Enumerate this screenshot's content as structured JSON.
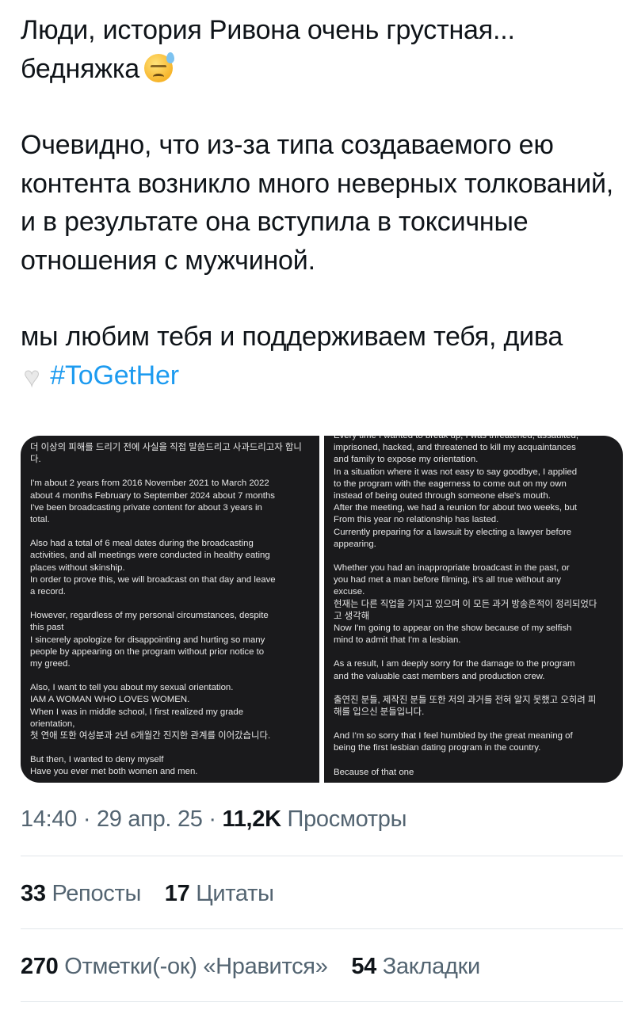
{
  "tweet": {
    "line1": "Люди, история Ривона очень грустная...",
    "line2": "бедняжка",
    "emoji_sad": "downcast-face-with-sweat-emoji",
    "para2": "Очевидно, что из-за типа создаваемого ею контента возникло много неверных толкований, и в результате она вступила в токсичные отношения с мужчиной.",
    "para3_text": "мы любим тебя и поддерживаем тебя, дива",
    "emoji_heart": "white-heart-emoji",
    "hashtag": "#ToGetHer",
    "hashtag_color": "#1d9bf0"
  },
  "media": {
    "left_paragraphs": [
      "더 이상의 피해를 드리기 전에 사실을 직접 말씀드리고 사과드리고자 합니다.",
      "I'm about 2 years from 2016 November 2021 to March 2022\nabout 4 months February to September 2024 about 7 months\nI've been broadcasting private content for about 3 years in\ntotal.",
      "Also had a total of 6 meal dates during the broadcasting\nactivities, and all meetings were conducted in healthy eating\nplaces without skinship.\nIn order to prove this, we will broadcast on that day and leave\na record.",
      "However, regardless of my personal circumstances, despite\nthis past\nI sincerely apologize for disappointing and hurting so many\npeople by appearing on the program without prior notice to\nmy greed.",
      "Also, I want to tell you about my sexual orientation.\nIAM A WOMAN WHO LOVES WOMEN.\nWhen I was in middle school, I first realized my grade\norientation,\n 첫 연애 또한 여성분과 2년 6개월간 진지한 관계를 이어갔습니다.",
      "But then, I wanted to deny myself\nHave you ever met both women and men."
    ],
    "right_paragraphs": [
      "Every time I wanted to break up, I was threatened, assaulted,\nimprisoned, hacked, and threatened to kill my acquaintances\nand family to expose my orientation.\nIn a situation where it was not easy to say goodbye, I applied\nto the program with the eagerness to come out on my own\ninstead of being outed through someone else's mouth.\nAfter the meeting, we had a reunion for about two weeks, but\nFrom this year no relationship has lasted.\nCurrently preparing for a lawsuit by electing a lawyer before\nappearing.",
      "Whether you had an inappropriate broadcast in the past, or\nyou had met a man before filming, it's all true without any\nexcuse.\n 현재는 다른 직업을 가지고 있으며 이 모든 과거 방송흔적이 정리되었다\n고 생각해\nNow I'm going to appear on the show because of my selfish\nmind to admit that I'm a lesbian.",
      "As a result, I am deeply sorry for the damage to the program\nand the valuable cast members and production crew.",
      " 출연진 분들, 제작진 분들 또한 저의 과거를 전혀 알지 못했고 오히려 피\n해를 입으신 분들입니다.",
      "And I'm so sorry that I feel humbled by the great meaning of\nbeing the first lesbian dating program in the country.",
      "Because of that one"
    ]
  },
  "meta": {
    "time": "14:40",
    "date": "29 апр. 25",
    "views_count": "11,2K",
    "views_label": "Просмотры"
  },
  "stats": {
    "reposts_count": "33",
    "reposts_label": "Репосты",
    "quotes_count": "17",
    "quotes_label": "Цитаты",
    "likes_count": "270",
    "likes_label": "Отметки(-ок) «Нравится»",
    "bookmarks_count": "54",
    "bookmarks_label": "Закладки"
  }
}
